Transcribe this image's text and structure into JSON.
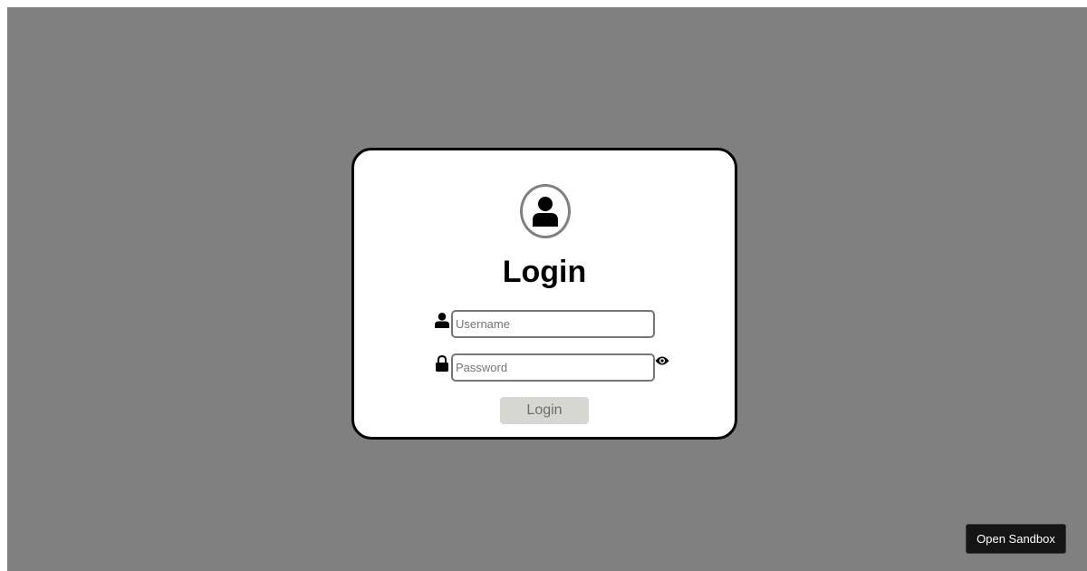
{
  "login_card": {
    "avatar_icon": "user-circle-icon",
    "title": "Login",
    "username": {
      "icon": "user-icon",
      "placeholder": "Username",
      "value": ""
    },
    "password": {
      "icon": "lock-icon",
      "placeholder": "Password",
      "value": "",
      "toggle_icon": "eye-icon"
    },
    "submit_label": "Login",
    "submit_state": "disabled"
  },
  "sandbox_button": {
    "label": "Open Sandbox"
  },
  "colors": {
    "backdrop": "#808080",
    "card": "#ffffff",
    "card_border": "#000000",
    "avatar_ring": "#808080",
    "button_disabled_bg": "#d6d6d3",
    "button_disabled_text": "#6d6d6d",
    "sandbox_bg": "#151515"
  }
}
